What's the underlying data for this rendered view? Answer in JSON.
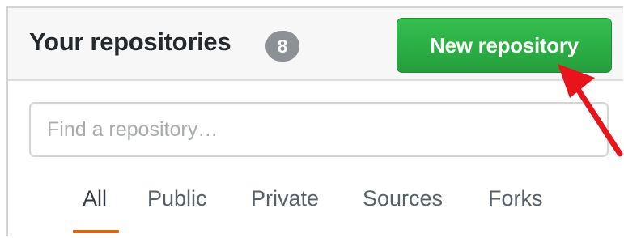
{
  "repositories": {
    "title": "Your repositories",
    "count": "8",
    "new_button_label": "New repository",
    "search": {
      "placeholder": "Find a repository…",
      "value": ""
    },
    "tabs": [
      {
        "label": "All",
        "selected": true
      },
      {
        "label": "Public",
        "selected": false
      },
      {
        "label": "Private",
        "selected": false
      },
      {
        "label": "Sources",
        "selected": false
      },
      {
        "label": "Forks",
        "selected": false
      }
    ]
  },
  "colors": {
    "button_green": "#2ea44f",
    "badge_gray": "#8d9094",
    "tab_underline_orange": "#e36209",
    "annotation_arrow_red": "#e8141c"
  }
}
